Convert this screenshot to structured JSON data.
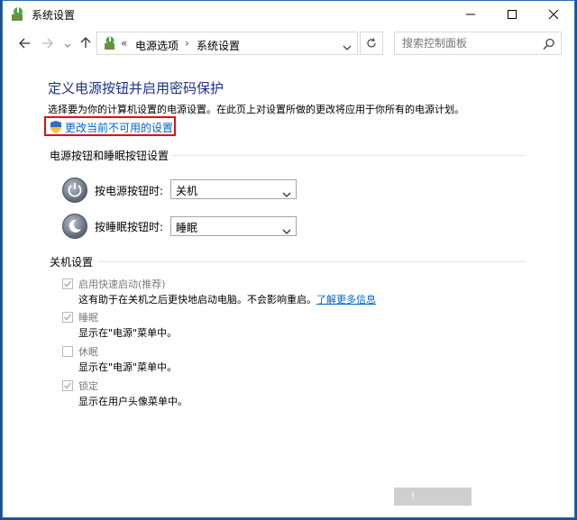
{
  "window": {
    "title": "系统设置",
    "minimize_icon": "minimize-icon",
    "maximize_icon": "maximize-icon",
    "close_icon": "close-icon"
  },
  "nav": {
    "back_icon": "back-arrow-icon",
    "forward_icon": "forward-arrow-icon",
    "up_icon": "up-arrow-icon"
  },
  "address": {
    "overflow": "«",
    "crumbs": [
      "电源选项",
      "系统设置"
    ],
    "separator": "›",
    "dropdown_icon": "chevron-down-icon"
  },
  "search": {
    "placeholder": "搜索控制面板",
    "icon": "search-icon"
  },
  "page": {
    "heading": "定义电源按钮并启用密码保护",
    "description": "选择要为你的计算机设置的电源设置。在此页上对设置所做的更改将应用于你所有的电源计划。",
    "change_link": "更改当前不可用的设置"
  },
  "power_group": {
    "label": "电源按钮和睡眠按钮设置",
    "rows": [
      {
        "label": "按电源按钮时:",
        "value": "关机"
      },
      {
        "label": "按睡眠按钮时:",
        "value": "睡眠"
      }
    ]
  },
  "shutdown_group": {
    "label": "关机设置",
    "items": [
      {
        "label": "启用快速启动(推荐)",
        "desc": "这有助于在关机之后更快地启动电脑。不会影响重启。",
        "link": "了解更多信息",
        "checked": true
      },
      {
        "label": "睡眠",
        "desc": "显示在\"电源\"菜单中。",
        "checked": true
      },
      {
        "label": "休眠",
        "desc": "显示在\"电源\"菜单中。",
        "checked": false
      },
      {
        "label": "锁定",
        "desc": "显示在用户头像菜单中。",
        "checked": true
      }
    ]
  },
  "footer": {
    "save_glyph": "!"
  },
  "colors": {
    "accent_link": "#0064c8",
    "heading": "#1e3287",
    "highlight_box": "#e01010"
  }
}
